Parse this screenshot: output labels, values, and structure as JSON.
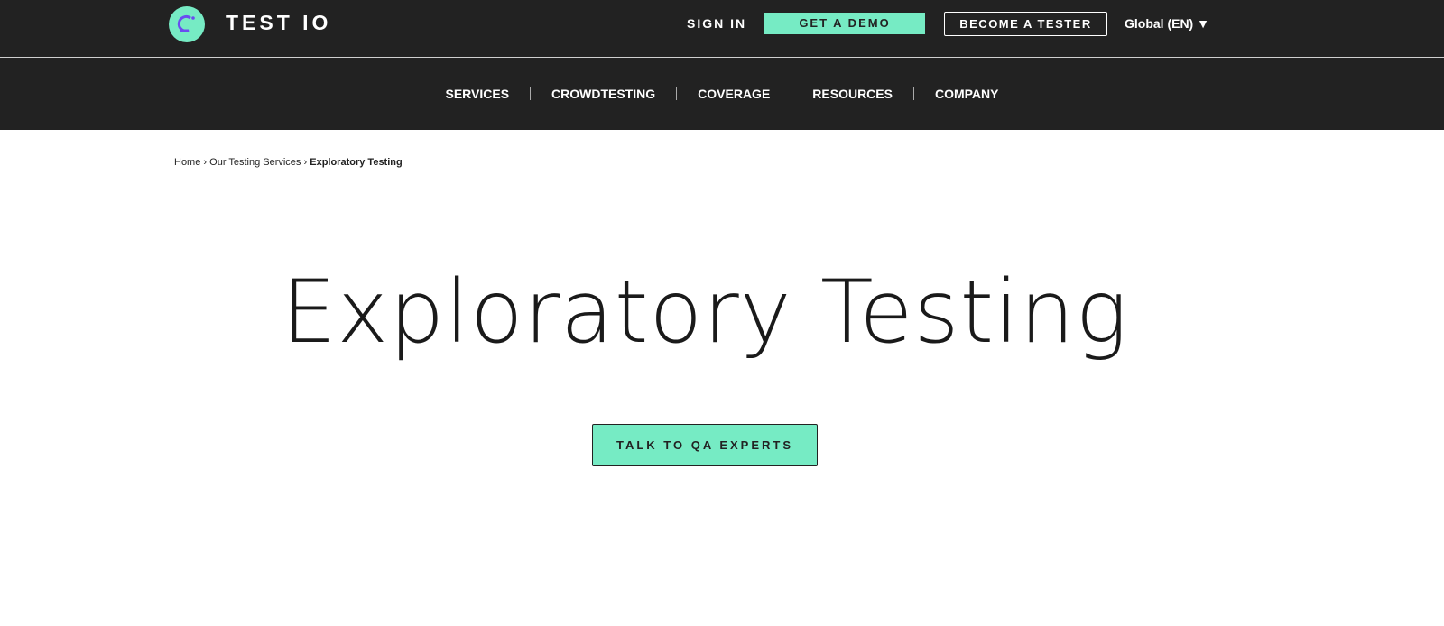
{
  "header": {
    "brand": "TEST IO",
    "sign_in": "SIGN IN",
    "get_demo": "GET A DEMO",
    "become_tester": "BECOME A TESTER",
    "language": "Global (EN)"
  },
  "nav": {
    "items": [
      "SERVICES",
      "CROWDTESTING",
      "COVERAGE",
      "RESOURCES",
      "COMPANY"
    ]
  },
  "breadcrumb": {
    "home": "Home",
    "services": "Our Testing Services",
    "current": "Exploratory Testing",
    "sep": "›"
  },
  "hero": {
    "title": "Exploratory Testing",
    "cta": "TALK TO QA EXPERTS"
  },
  "colors": {
    "accent": "#76ebc4",
    "dark": "#222222",
    "logo_mark": "#6a4cf0"
  }
}
